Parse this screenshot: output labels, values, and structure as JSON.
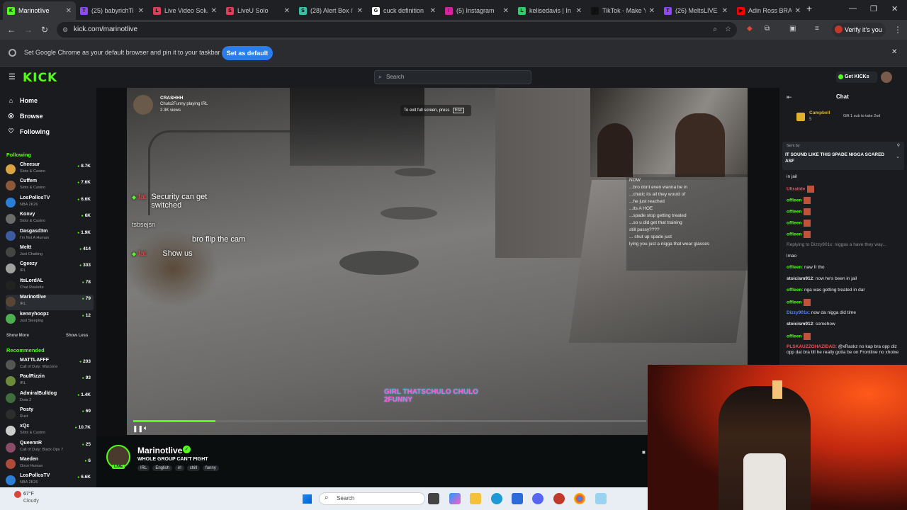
{
  "browser": {
    "tabs": [
      {
        "title": "Marinotlive",
        "favicon_color": "#53fc18",
        "favicon_letter": "K"
      },
      {
        "title": "(25) babyrichTi",
        "favicon_color": "#9146ff",
        "favicon_letter": "T"
      },
      {
        "title": "Live Video Solu",
        "favicon_color": "#e33b5a",
        "favicon_letter": "L"
      },
      {
        "title": "LiveU Solo",
        "favicon_color": "#e33b5a",
        "favicon_letter": "S"
      },
      {
        "title": "(28) Alert Box /",
        "favicon_color": "#31c3a2",
        "favicon_letter": "S"
      },
      {
        "title": "cuck definition",
        "favicon_color": "#ffffff",
        "favicon_letter": "G"
      },
      {
        "title": "(5) Instagram",
        "favicon_color": "#d6249f",
        "favicon_letter": "I"
      },
      {
        "title": "kelisedavis | In",
        "favicon_color": "#25d366",
        "favicon_letter": "L"
      },
      {
        "title": "TikTok - Make Y",
        "favicon_color": "#111111",
        "favicon_letter": "♪"
      },
      {
        "title": "(26) MeltsLIVE",
        "favicon_color": "#9146ff",
        "favicon_letter": "T"
      },
      {
        "title": "Adin Ross BRAN",
        "favicon_color": "#ff0000",
        "favicon_letter": "▶"
      }
    ],
    "new_tab": "+",
    "url": "kick.com/marinotlive",
    "verify_label": "Verify it's you",
    "infobar_message": "Set Google Chrome as your default browser and pin it to your taskbar",
    "set_default_label": "Set as default",
    "close_glyph": "✕"
  },
  "kick": {
    "logo": "KICK",
    "search_placeholder": "Search",
    "get_kicks": "Get KICKs"
  },
  "sidebar": {
    "nav": [
      {
        "label": "Home",
        "icon": "home-icon"
      },
      {
        "label": "Browse",
        "icon": "browse-icon"
      },
      {
        "label": "Following",
        "icon": "heart-icon"
      }
    ],
    "following_title": "Following",
    "following": [
      {
        "name": "Cheesur",
        "category": "Slots & Casino",
        "viewers": "8.7K",
        "color": "#d9a441"
      },
      {
        "name": "Cuffem",
        "category": "Slots & Casino",
        "viewers": "7.6K",
        "color": "#8a5a3b"
      },
      {
        "name": "LosPollosTV",
        "category": "NBA 2K26",
        "viewers": "6.6K",
        "color": "#2a7fd4"
      },
      {
        "name": "Konvy",
        "category": "Slots & Casino",
        "viewers": "6K",
        "color": "#6b6b6b"
      },
      {
        "name": "Dasgasd3m",
        "category": "I'm Not A Human",
        "viewers": "1.9K",
        "color": "#3d5c9e"
      },
      {
        "name": "Meltt",
        "category": "Just Chatting",
        "viewers": "414",
        "color": "#444444"
      },
      {
        "name": "Cgeezy",
        "category": "IRL",
        "viewers": "303",
        "color": "#a0a0a0"
      },
      {
        "name": "ItsLordAL",
        "category": "Chat Roulette",
        "viewers": "78",
        "color": "#222222"
      },
      {
        "name": "Marinotlive",
        "category": "IRL",
        "viewers": "79",
        "color": "#5a4535"
      },
      {
        "name": "kennyhoopz",
        "category": "Just Sleeping",
        "viewers": "12",
        "color": "#4caf50"
      }
    ],
    "show_more": "Show More",
    "show_less": "Show Less",
    "recommended_title": "Recommended",
    "recommended": [
      {
        "name": "MATTLAFFF",
        "category": "Call of Duty: Warzone",
        "viewers": "203",
        "color": "#555555"
      },
      {
        "name": "PaulRizzin",
        "category": "IRL",
        "viewers": "93",
        "color": "#6d8a3b"
      },
      {
        "name": "AdmiralBulldog",
        "category": "Dota 2",
        "viewers": "1.4K",
        "color": "#3f6d3b"
      },
      {
        "name": "Posty",
        "category": "Rust",
        "viewers": "69",
        "color": "#2d2d2d"
      },
      {
        "name": "xQc",
        "category": "Slots & Casino",
        "viewers": "10.7K",
        "color": "#cccccc"
      },
      {
        "name": "QueennR",
        "category": "Call of Duty: Black Ops 7",
        "viewers": "25",
        "color": "#8a4a6a"
      },
      {
        "name": "Maeden",
        "category": "Once Human",
        "viewers": "6",
        "color": "#b04a3a"
      },
      {
        "name": "LosPollosTV",
        "category": "NBA 2K26",
        "viewers": "6.6K",
        "color": "#2a7fd4"
      }
    ]
  },
  "video": {
    "streamer_tag_name": "CRASHHH",
    "streamer_tag_sub": "Chulo2Funny playing IRL",
    "streamer_tag_views": "2.3K views",
    "exit_fullscreen_hint": "To exit full screen, press",
    "exit_key": "Esc",
    "messages": [
      {
        "user": "fat",
        "text": "Security can get switched"
      },
      {
        "user": "tsbsejsn",
        "text": ""
      },
      {
        "user": "",
        "text": "bro flip the cam"
      },
      {
        "user": "fat",
        "text": "Show us"
      }
    ],
    "overlay_chat": [
      "NOW",
      "...bro dont even wanna be in",
      "...chatic its all they would of",
      "...he just reached",
      "...its A HOE",
      "...spade stop getting treated",
      "...so u did get that training",
      "still pussy????",
      "... shut up spade just",
      "lying you just a nigga that wear glasses"
    ],
    "brand_watermark": "GIRL THATSCHULO CHULO 2FUNNY",
    "progress_fraction": 0.16
  },
  "stream": {
    "channel_name": "Marinotlive",
    "live_label": "LIVE",
    "title": "WHOLE GROUP CAN'T FIGHT",
    "tags": [
      "IRL",
      "English",
      "irl",
      "chill",
      "funny"
    ]
  },
  "chat": {
    "title": "Chat",
    "pinned_user": "Campbell",
    "pinned_sub": "5",
    "pinned_gift": "Gift 1 sub to take 2nd",
    "pinned_message_from": "Sent by",
    "pinned_message": "IT SOUND LIKE THIS SPADE NIGGA SCARED ASF",
    "lines": [
      {
        "user": "",
        "text": "in jail",
        "color": "#eaeaea"
      },
      {
        "user": "Ultratide",
        "text": "",
        "color": "#ff4b4b"
      },
      {
        "user": "offleen",
        "text": "",
        "color": "#53fc18"
      },
      {
        "user": "offleen",
        "text": "",
        "color": "#53fc18"
      },
      {
        "user": "offleen",
        "text": "",
        "color": "#53fc18"
      },
      {
        "user": "offleen",
        "text": "",
        "color": "#53fc18"
      },
      {
        "user": "",
        "text": "Replying to Dizzy901x: niggas a have they way...",
        "color": "#8a8a8a"
      },
      {
        "user": "",
        "text": "lmao",
        "color": "#eaeaea"
      },
      {
        "user": "offleen",
        "text": "naw fr tho",
        "color": "#53fc18"
      },
      {
        "user": "stoicism912",
        "text": "now he's been in jail",
        "color": "#eaeaea"
      },
      {
        "user": "offleen",
        "text": "nga was getting treated in dar",
        "color": "#53fc18"
      },
      {
        "user": "offleen",
        "text": "",
        "color": "#53fc18"
      },
      {
        "user": "Dizzy901x",
        "text": "now da nigga did time",
        "color": "#4a8cff"
      },
      {
        "user": "stoicism912",
        "text": "somehow",
        "color": "#eaeaea"
      },
      {
        "user": "offleen",
        "text": "",
        "color": "#53fc18"
      },
      {
        "user": "PLSKAUZZOHAZIDAD",
        "text": "@xRaxkz no kap bra opp diz opp dat bra till he really gotta be on Frontline no xhoixe",
        "color": "#ff4b4b"
      }
    ]
  },
  "taskbar": {
    "weather_temp": "67°F",
    "weather_desc": "Cloudy",
    "search_label": "Search"
  }
}
